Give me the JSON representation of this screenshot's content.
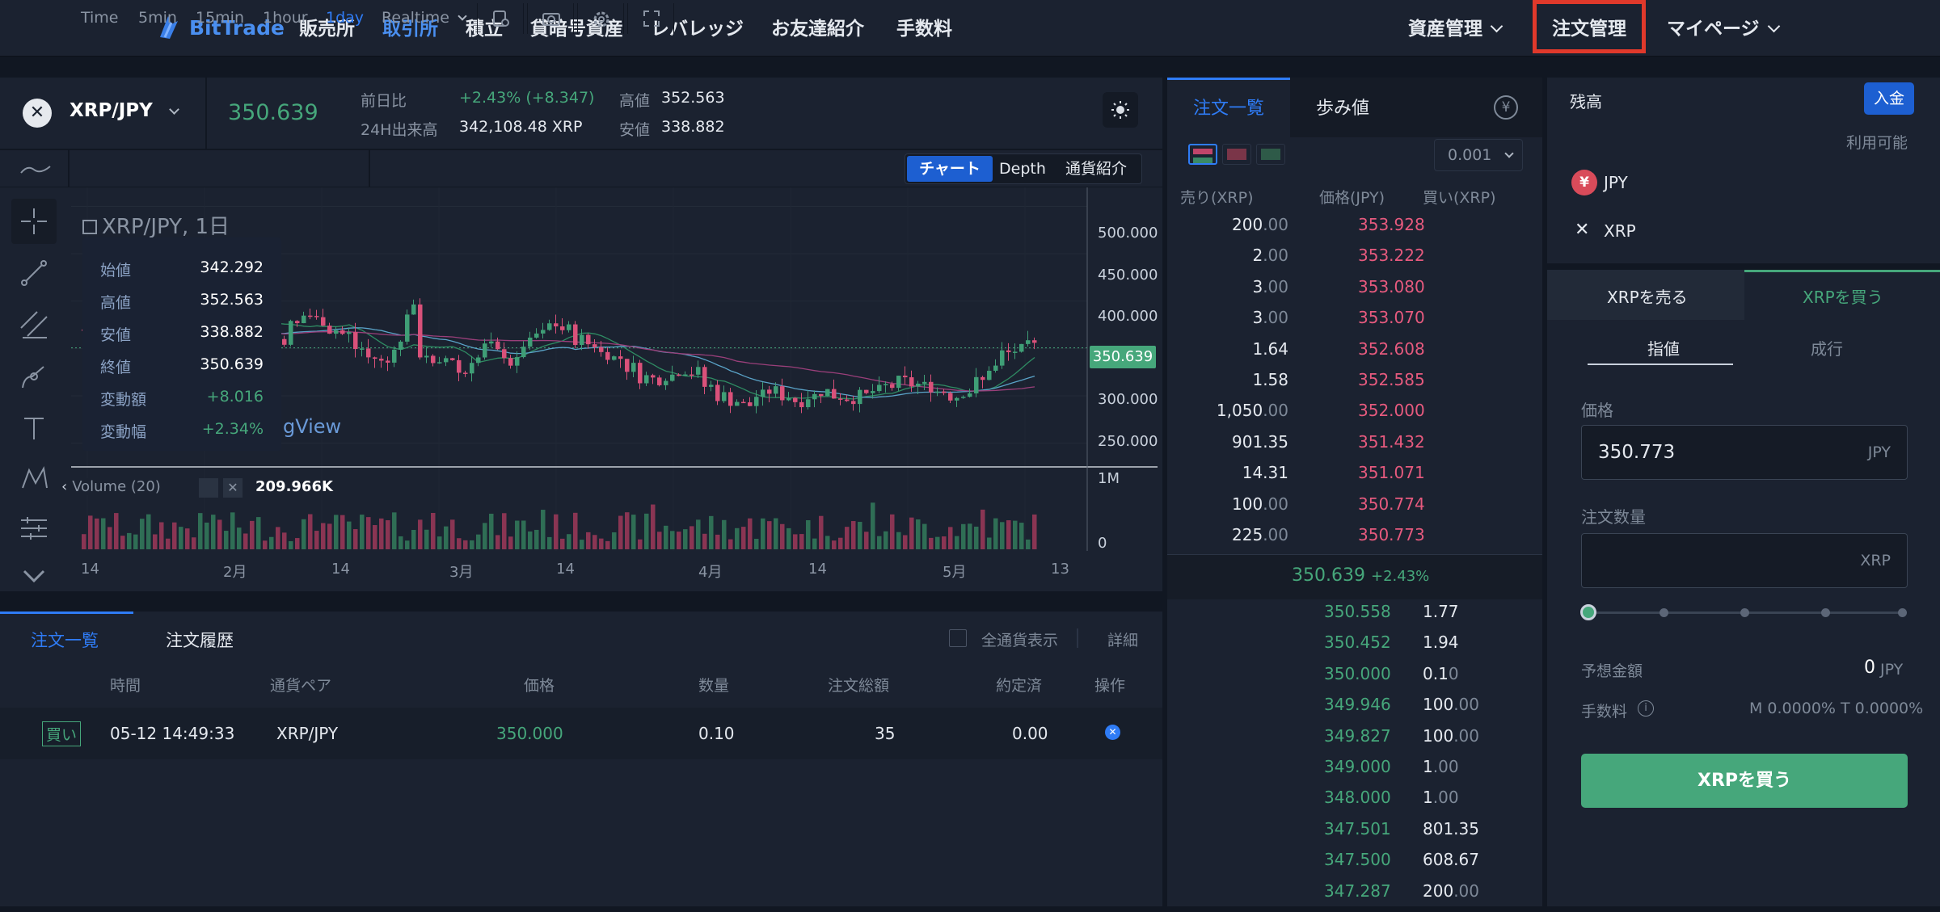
{
  "nav": {
    "logo": "BitTrade",
    "links": [
      "販売所",
      "取引所",
      "積立",
      "貸暗号資産",
      "レバレッジ",
      "お友達紹介",
      "手数料"
    ],
    "active_link": "取引所",
    "asset_mgmt": "資産管理",
    "order_mgmt": "注文管理",
    "mypage": "マイページ"
  },
  "ticker": {
    "pair": "XRP/JPY",
    "price": "350.639",
    "change_label": "前日比",
    "change_value": "+2.43% (+8.347)",
    "volume_label": "24H出来高",
    "volume_value": "342,108.48 XRP",
    "high_label": "高値",
    "high_value": "352.563",
    "low_label": "安値",
    "low_value": "338.882"
  },
  "toolbar": {
    "intervals": [
      "Time",
      "5min",
      "15min",
      "1hour",
      "1day"
    ],
    "active_interval": "1day",
    "realtime": "Realtime",
    "views": [
      "チャート",
      "Depth",
      "通貨紹介"
    ],
    "active_view": "チャート"
  },
  "chart": {
    "title": "XRP/JPY, 1日",
    "watermark": "gView",
    "ohlc_tooltip": [
      {
        "label": "始値",
        "value": "342.292"
      },
      {
        "label": "高値",
        "value": "352.563"
      },
      {
        "label": "安値",
        "value": "338.882"
      },
      {
        "label": "終値",
        "value": "350.639"
      },
      {
        "label": "変動額",
        "value": "+8.016"
      },
      {
        "label": "変動幅",
        "value": "+2.34%"
      }
    ],
    "price_axis": [
      "500.000",
      "450.000",
      "400.000",
      "350.000",
      "300.000",
      "250.000"
    ],
    "last_price_label": "350.639",
    "volume_label": "Volume (20)",
    "volume_value": "209.966K",
    "volume_axis": [
      "1M",
      "0"
    ],
    "time_axis": [
      "14",
      "2月",
      "14",
      "3月",
      "14",
      "4月",
      "14",
      "5月",
      "13"
    ]
  },
  "chart_data": {
    "type": "candlestick",
    "title": "XRP/JPY, 1日",
    "price_range": [
      225,
      520
    ],
    "last_price": 350.639,
    "volume_range": [
      0,
      1000000
    ],
    "volume_last": 209966
  },
  "orders": {
    "tabs": [
      "注文一覧",
      "注文履歴"
    ],
    "active_tab": "注文一覧",
    "show_all_label": "全通貨表示",
    "detail_label": "詳細",
    "columns": [
      "時間",
      "通貨ペア",
      "価格",
      "数量",
      "注文総額",
      "約定済",
      "操作"
    ],
    "rows": [
      {
        "side": "買い",
        "time": "05-12 14:49:33",
        "pair": "XRP/JPY",
        "price": "350.000",
        "qty": "0.10",
        "total": "35",
        "filled": "0.00"
      }
    ]
  },
  "book": {
    "tabs": [
      "注文一覧",
      "歩み値"
    ],
    "active_tab": "注文一覧",
    "precision": "0.001",
    "columns": [
      "売り(XRP)",
      "価格(JPY)",
      "買い(XRP)"
    ],
    "asks": [
      {
        "qty": "200",
        "dec": ".00",
        "price": "353.928"
      },
      {
        "qty": "2",
        "dec": ".00",
        "price": "353.222"
      },
      {
        "qty": "3",
        "dec": ".00",
        "price": "353.080"
      },
      {
        "qty": "3",
        "dec": ".00",
        "price": "353.070"
      },
      {
        "qty": "1.64",
        "dec": "",
        "price": "352.608"
      },
      {
        "qty": "1.58",
        "dec": "",
        "price": "352.585"
      },
      {
        "qty": "1,050",
        "dec": ".00",
        "price": "352.000"
      },
      {
        "qty": "901.35",
        "dec": "",
        "price": "351.432"
      },
      {
        "qty": "14.31",
        "dec": "",
        "price": "351.071"
      },
      {
        "qty": "100",
        "dec": ".00",
        "price": "350.774"
      },
      {
        "qty": "225",
        "dec": ".00",
        "price": "350.773"
      }
    ],
    "mid_price": "350.639",
    "mid_change": "+2.43%",
    "bids": [
      {
        "price": "350.558",
        "qty": "1.77",
        "dec": ""
      },
      {
        "price": "350.452",
        "qty": "1.94",
        "dec": ""
      },
      {
        "price": "350.000",
        "qty": "0.1",
        "dec": "0"
      },
      {
        "price": "349.946",
        "qty": "100",
        "dec": ".00"
      },
      {
        "price": "349.827",
        "qty": "100",
        "dec": ".00"
      },
      {
        "price": "349.000",
        "qty": "1",
        "dec": ".00"
      },
      {
        "price": "348.000",
        "qty": "1",
        "dec": ".00"
      },
      {
        "price": "347.501",
        "qty": "801.35",
        "dec": ""
      },
      {
        "price": "347.500",
        "qty": "608.67",
        "dec": ""
      },
      {
        "price": "347.287",
        "qty": "200",
        "dec": ".00"
      }
    ]
  },
  "trade": {
    "balance_label": "残高",
    "deposit_label": "入金",
    "available_label": "利用可能",
    "currencies": [
      {
        "code": "JPY",
        "icon": "yen-icon"
      },
      {
        "code": "XRP",
        "icon": "xrp-icon"
      }
    ],
    "sell_tab": "XRPを売る",
    "buy_tab": "XRPを買う",
    "active_side": "XRPを買う",
    "order_types": [
      "指値",
      "成行"
    ],
    "active_order_type": "指値",
    "price_label": "価格",
    "price_value": "350.773",
    "price_unit": "JPY",
    "qty_label": "注文数量",
    "qty_value": "",
    "qty_unit": "XRP",
    "slider_value": 0,
    "est_label": "予想金額",
    "est_value": "0",
    "est_unit": "JPY",
    "fee_label": "手数料",
    "fee_value": "M 0.0000% T 0.0000%",
    "buy_button": "XRPを買う"
  },
  "colors": {
    "accent": "#2f7cf6",
    "buy": "#46a77b",
    "sell": "#e65a7e",
    "highlight": "#e0392b"
  }
}
